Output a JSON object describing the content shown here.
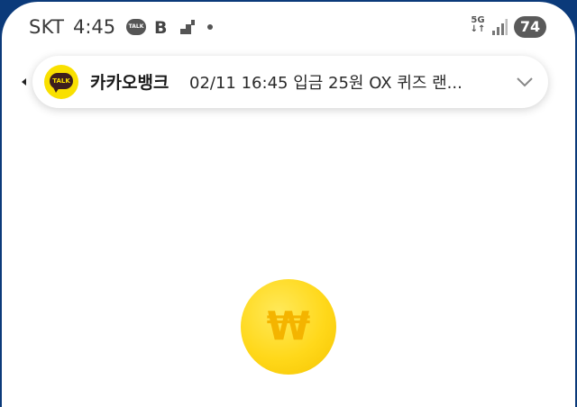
{
  "status_bar": {
    "carrier": "SKT",
    "time": "4:45",
    "talk_icon_text": "TALK",
    "b_icon_text": "B",
    "network": "5G",
    "battery": "74"
  },
  "notification": {
    "app_icon_text": "TALK",
    "sender": "카카오뱅크",
    "message": "02/11 16:45 입금 25원 OX 퀴즈 랜..."
  },
  "coin": {
    "symbol": "₩"
  },
  "colors": {
    "kakao_yellow": "#f9e000",
    "coin_yellow": "#ffd81a",
    "frame_blue": "#0b3a7a"
  }
}
